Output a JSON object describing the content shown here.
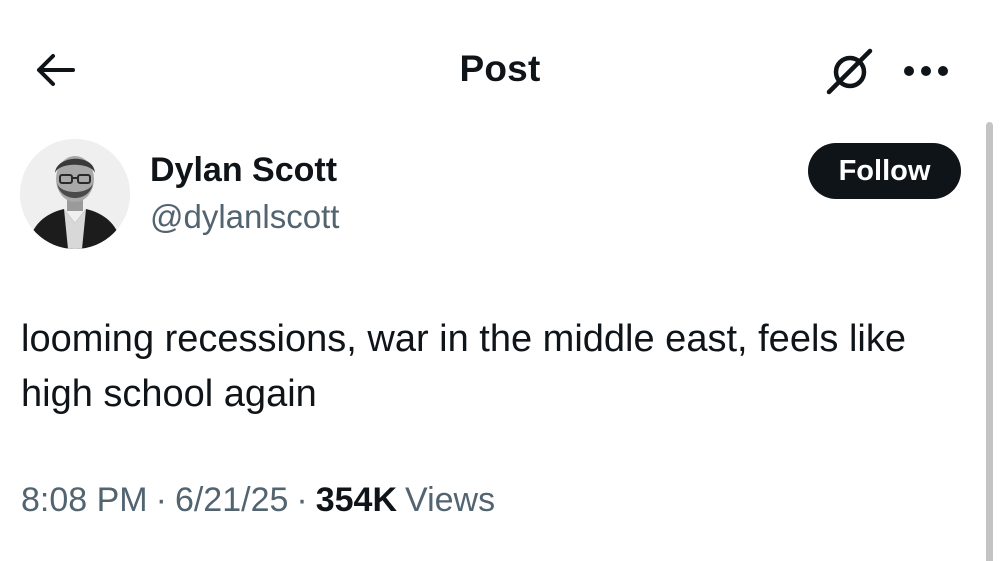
{
  "header": {
    "title": "Post",
    "back_icon": "arrow-left-icon",
    "grok_icon": "grok-icon",
    "more_icon": "more-horizontal-icon"
  },
  "author": {
    "name": "Dylan Scott",
    "handle": "@dylanlscott",
    "avatar_icon": "avatar",
    "follow_label": "Follow"
  },
  "post": {
    "text": "looming recessions, war in the middle east, feels like high school again"
  },
  "meta": {
    "time": "8:08 PM",
    "separator": "·",
    "date": "6/21/25",
    "views_count": "354K",
    "views_label": "Views"
  },
  "colors": {
    "text_primary": "#0f1419",
    "text_secondary": "#536471",
    "button_bg": "#0f1419",
    "button_text": "#ffffff",
    "background": "#ffffff"
  }
}
